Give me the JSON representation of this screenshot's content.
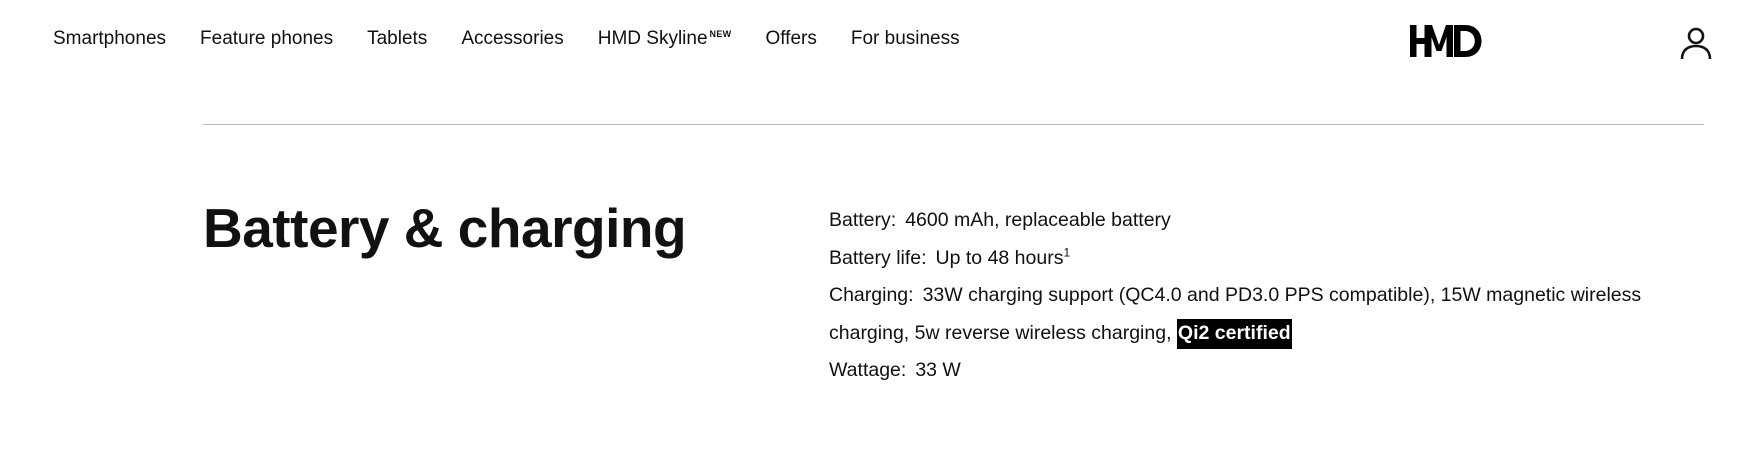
{
  "nav": {
    "items": [
      {
        "label": "Smartphones"
      },
      {
        "label": "Feature phones"
      },
      {
        "label": "Tablets"
      },
      {
        "label": "Accessories"
      },
      {
        "label": "HMD Skyline",
        "badge": "NEW"
      },
      {
        "label": "Offers"
      },
      {
        "label": "For business"
      }
    ],
    "logo_text": "HMD",
    "account_icon": "user-icon"
  },
  "section": {
    "title": "Battery & charging",
    "specs": {
      "battery": {
        "label": "Battery",
        "value": "4600 mAh, replaceable battery"
      },
      "battery_life": {
        "label": "Battery life",
        "value": "Up to 48 hours",
        "footnote": "1"
      },
      "charging": {
        "label": "Charging",
        "value": "33W charging support (QC4.0 and PD3.0 PPS compatible), 15W magnetic wireless charging, 5w reverse wireless charging,",
        "highlight": "Qi2 certified"
      },
      "wattage": {
        "label": "Wattage",
        "value": "33 W"
      }
    }
  },
  "colors": {
    "text": "#111111",
    "divider": "#b8b8b8",
    "highlight_bg": "#000000",
    "highlight_text": "#ffffff"
  }
}
